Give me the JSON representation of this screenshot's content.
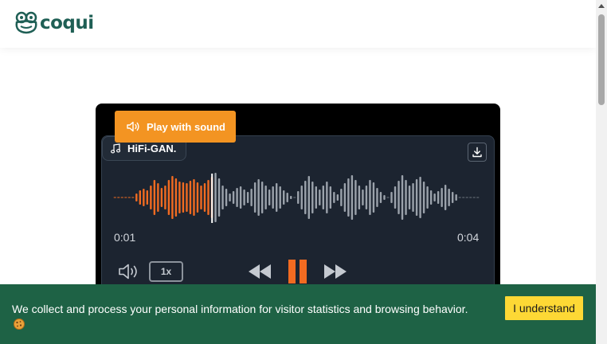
{
  "brand": {
    "name": "coqui",
    "color": "#1f5f55"
  },
  "player": {
    "play_with_sound_label": "Play with sound",
    "track_name": "HiFi-GAN.",
    "time_current": "0:01",
    "time_total": "0:04",
    "speed_label": "1x",
    "progress_fraction": 0.27,
    "accent_color": "#f26b21",
    "unplayed_color": "#9ba2ab"
  },
  "cookie": {
    "message": "We collect and process your personal information for visitor statistics and browsing behavior.",
    "accept_label": "I understand",
    "background": "#1e6245",
    "button_color": "#fdd835"
  },
  "icons": {
    "logo": "frog-logo-icon",
    "speaker": "speaker-icon",
    "music_note": "music-note-icon",
    "download": "download-icon",
    "volume": "volume-icon",
    "rewind": "rewind-icon",
    "pause": "pause-icon",
    "forward": "fast-forward-icon",
    "cookie": "cookie-icon"
  }
}
